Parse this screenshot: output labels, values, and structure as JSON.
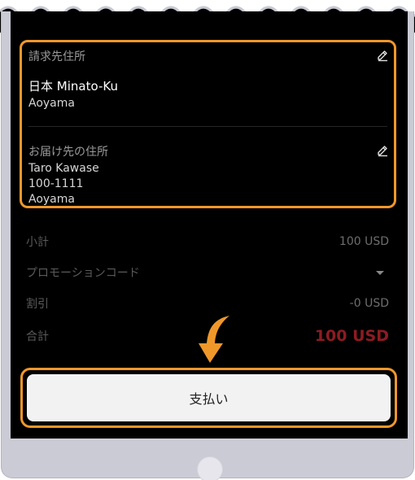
{
  "billing": {
    "title": "請求先住所",
    "country": "日本",
    "city": "Minato-Ku",
    "district": "Aoyama"
  },
  "shipping": {
    "title": "お届け先の住所",
    "name": "Taro Kawase",
    "postal": "100-1111",
    "district": "Aoyama"
  },
  "summary": {
    "subtotal_label": "小計",
    "subtotal_value": "100 USD",
    "promo_label": "プロモーションコード",
    "discount_label": "割引",
    "discount_value": "-0 USD",
    "total_label": "合計",
    "total_value": "100 USD"
  },
  "pay_button_label": "支払い",
  "colors": {
    "accent_highlight": "#f0972a",
    "total": "#8e1b22",
    "screen_bg": "#000000",
    "device_frame": "#cbcbd6"
  },
  "icons": {
    "edit": "pencil-icon",
    "promo_toggle": "caret-down-icon",
    "hint": "curved-arrow-down-icon"
  }
}
